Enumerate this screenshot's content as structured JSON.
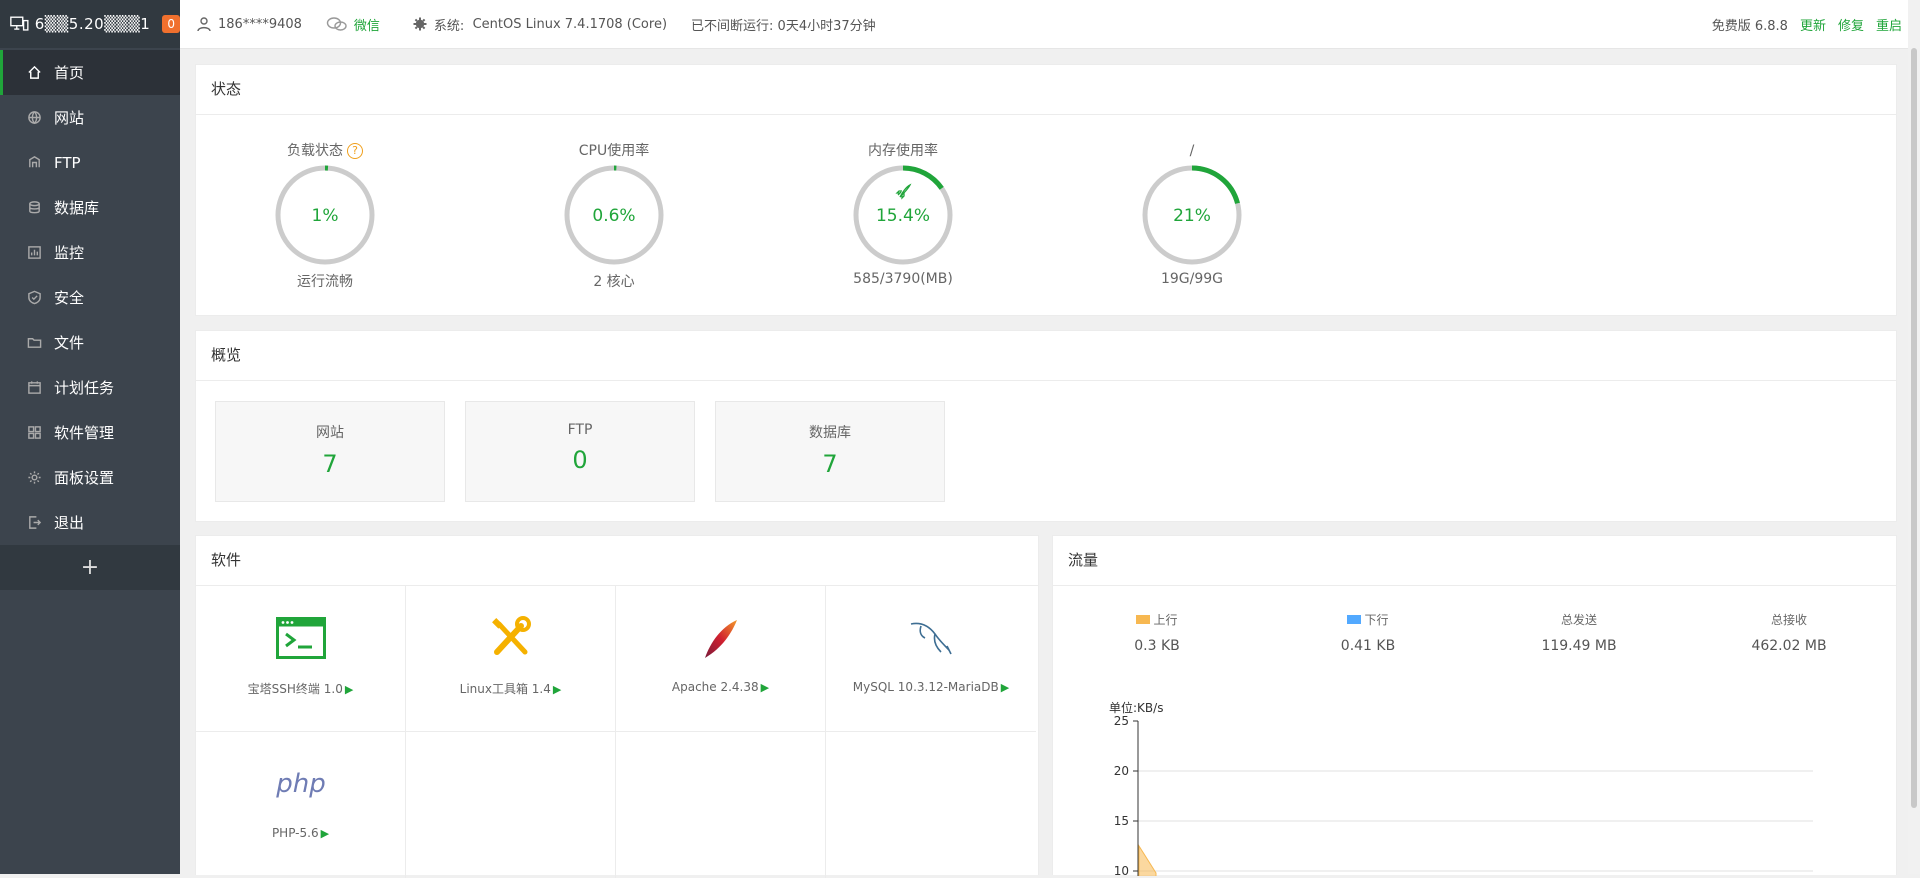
{
  "sidebar": {
    "server_ip": "6▒▒5.20▒▒▒1",
    "badge": "0",
    "items": [
      {
        "label": "首页",
        "icon": "home-icon"
      },
      {
        "label": "网站",
        "icon": "globe-icon"
      },
      {
        "label": "FTP",
        "icon": "ftp-icon"
      },
      {
        "label": "数据库",
        "icon": "database-icon"
      },
      {
        "label": "监控",
        "icon": "monitor-chart-icon"
      },
      {
        "label": "安全",
        "icon": "shield-icon"
      },
      {
        "label": "文件",
        "icon": "folder-icon"
      },
      {
        "label": "计划任务",
        "icon": "calendar-icon"
      },
      {
        "label": "软件管理",
        "icon": "grid-icon"
      },
      {
        "label": "面板设置",
        "icon": "gear-icon"
      },
      {
        "label": "退出",
        "icon": "logout-icon"
      }
    ],
    "add_label": "+"
  },
  "header": {
    "user": "186****9408",
    "wechat": "微信",
    "system_label": "系统:",
    "system_value": "CentOS Linux 7.4.1708 (Core)",
    "uptime": "已不间断运行: 0天4小时37分钟",
    "version": "免费版 6.8.8",
    "update": "更新",
    "repair": "修复",
    "restart": "重启"
  },
  "status": {
    "title": "状态",
    "gauges": [
      {
        "title": "负载状态",
        "value": "1%",
        "percent": 1,
        "sub": "运行流畅",
        "help": "?"
      },
      {
        "title": "CPU使用率",
        "value": "0.6%",
        "percent": 0.6,
        "sub": "2 核心"
      },
      {
        "title": "内存使用率",
        "value": "15.4%",
        "percent": 15.4,
        "sub": "585/3790(MB)"
      },
      {
        "title": "/",
        "value": "21%",
        "percent": 21,
        "sub": "19G/99G"
      }
    ]
  },
  "overview": {
    "title": "概览",
    "boxes": [
      {
        "label": "网站",
        "value": "7"
      },
      {
        "label": "FTP",
        "value": "0"
      },
      {
        "label": "数据库",
        "value": "7"
      }
    ]
  },
  "software": {
    "title": "软件",
    "items": [
      {
        "name": "宝塔SSH终端 1.0",
        "icon": "terminal-icon"
      },
      {
        "name": "Linux工具箱 1.4",
        "icon": "tools-icon"
      },
      {
        "name": "Apache 2.4.38",
        "icon": "apache-feather-icon"
      },
      {
        "name": "MySQL 10.3.12-MariaDB",
        "icon": "mysql-dolphin-icon"
      },
      {
        "name": "PHP-5.6",
        "icon": "php-icon"
      }
    ],
    "play": "▶",
    "php_logo": "php"
  },
  "traffic": {
    "title": "流量",
    "stats": [
      {
        "label": "上行",
        "value": "0.3 KB",
        "color": "#f7b851"
      },
      {
        "label": "下行",
        "value": "0.41 KB",
        "color": "#52a9ff"
      },
      {
        "label": "总发送",
        "value": "119.49 MB"
      },
      {
        "label": "总接收",
        "value": "462.02 MB"
      }
    ],
    "unit": "单位:KB/s"
  },
  "chart_data": {
    "type": "area",
    "ylabel": "单位:KB/s",
    "yticks": [
      25,
      20,
      15,
      10
    ],
    "ylim": [
      0,
      25
    ],
    "series": [
      {
        "name": "上行",
        "color": "#f7b851",
        "values": [
          12.5,
          9.8
        ]
      }
    ]
  },
  "colors": {
    "accent": "#20a53a",
    "sidebar_bg": "#3c444d",
    "badge": "#f0702e"
  }
}
